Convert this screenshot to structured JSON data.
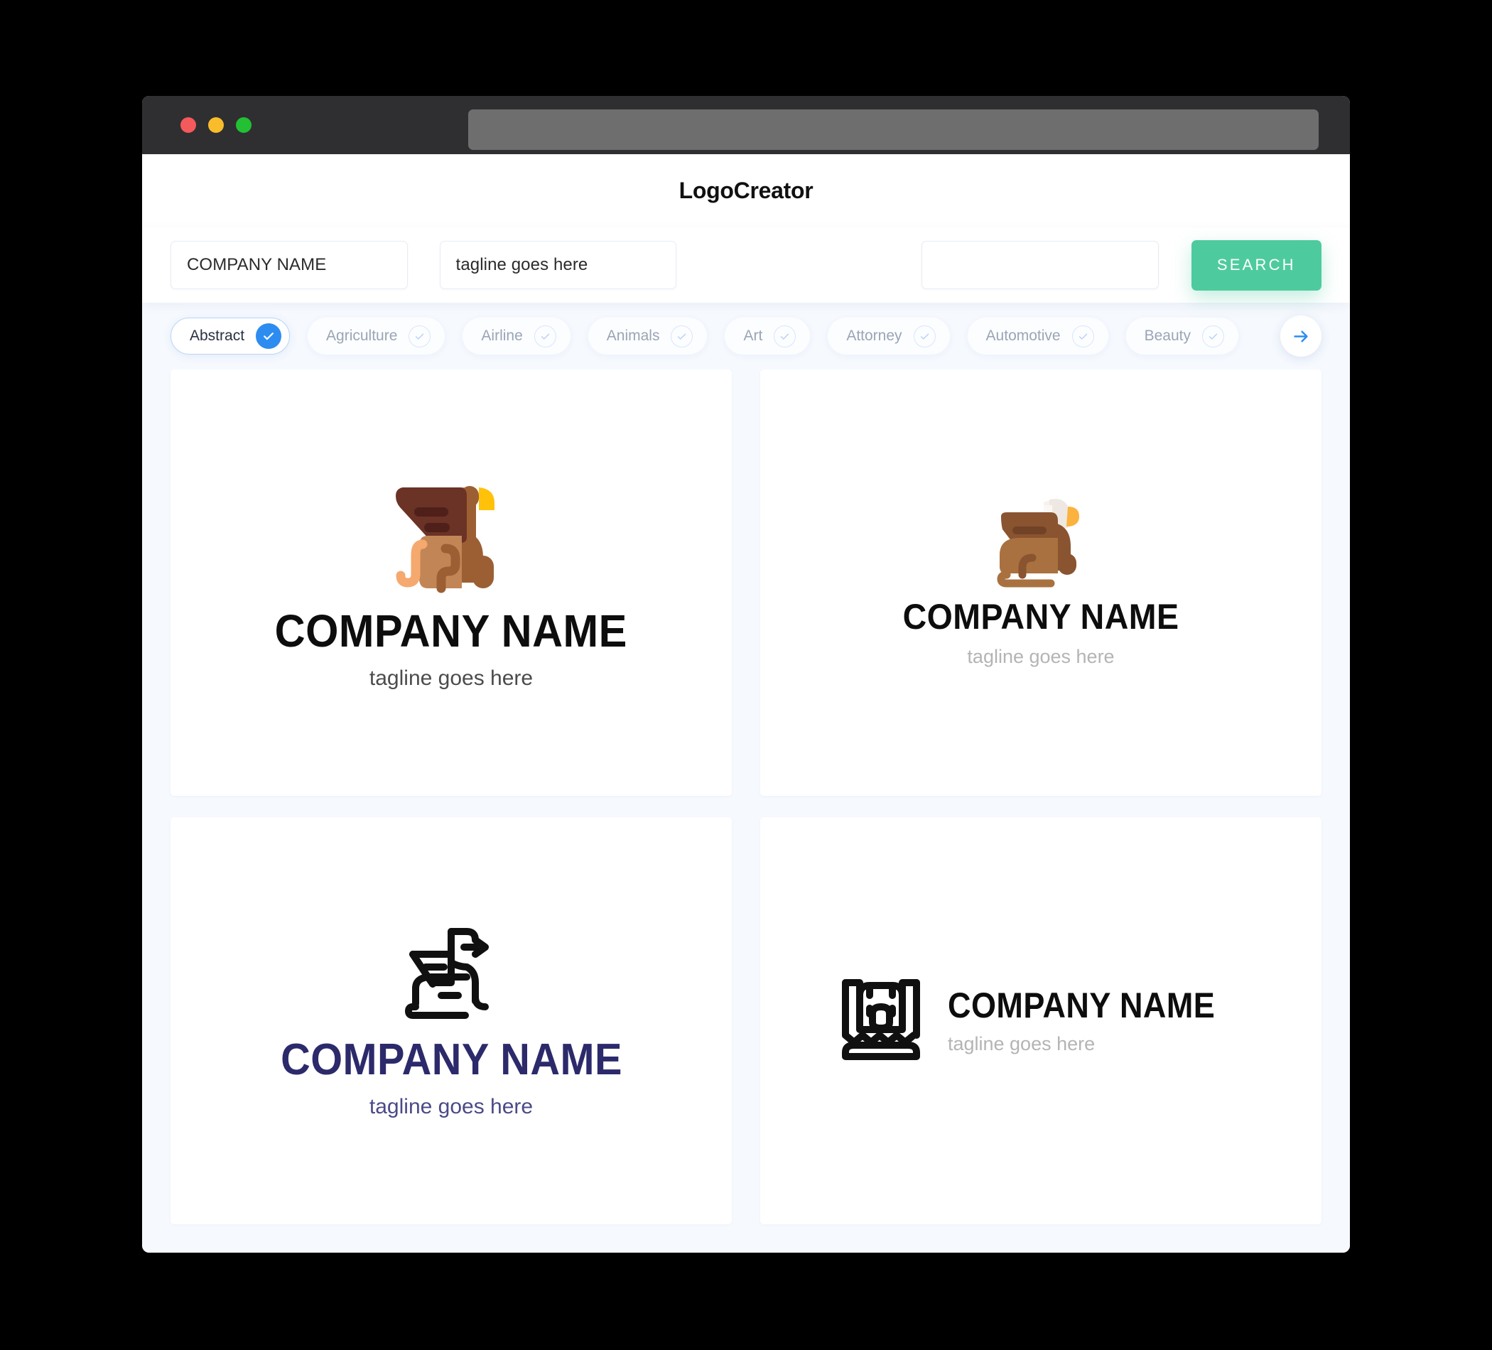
{
  "window": {
    "traffic_lights": [
      {
        "name": "close",
        "color": "#f4595b"
      },
      {
        "name": "minimize",
        "color": "#f9bc2b"
      },
      {
        "name": "maximize",
        "color": "#22c032"
      }
    ],
    "url_value": ""
  },
  "header": {
    "app_title": "LogoCreator"
  },
  "search": {
    "company_value": "COMPANY NAME",
    "company_placeholder": "COMPANY NAME",
    "tagline_value": "tagline goes here",
    "tagline_placeholder": "tagline goes here",
    "extra_value": "",
    "extra_placeholder": "",
    "search_label": "SEARCH",
    "search_button_color": "#4ecb9e"
  },
  "categories": {
    "next_icon": "arrow-right-icon",
    "selected_color": "#2d8cf0",
    "items": [
      {
        "label": "Abstract",
        "selected": true
      },
      {
        "label": "Agriculture",
        "selected": false
      },
      {
        "label": "Airline",
        "selected": false
      },
      {
        "label": "Animals",
        "selected": false
      },
      {
        "label": "Art",
        "selected": false
      },
      {
        "label": "Attorney",
        "selected": false
      },
      {
        "label": "Automotive",
        "selected": false
      },
      {
        "label": "Beauty",
        "selected": false
      }
    ]
  },
  "results": [
    {
      "icon": "griffin-sitting-color-icon",
      "name": "COMPANY NAME",
      "tagline": "tagline goes here",
      "name_color": "#0d0d0d",
      "tagline_color": "#4c4c4c"
    },
    {
      "icon": "griffin-lying-color-icon",
      "name": "COMPANY NAME",
      "tagline": "tagline goes here",
      "name_color": "#0d0d0d",
      "tagline_color": "#b4b4b4"
    },
    {
      "icon": "griffin-outline-icon",
      "name": "COMPANY NAME",
      "tagline": "tagline goes here",
      "name_color": "#2c2a6b",
      "tagline_color": "#4b4a87"
    },
    {
      "icon": "griffin-head-outline-icon",
      "name": "COMPANY NAME",
      "tagline": "tagline goes here",
      "name_color": "#0d0d0d",
      "tagline_color": "#b4b4b4"
    }
  ]
}
